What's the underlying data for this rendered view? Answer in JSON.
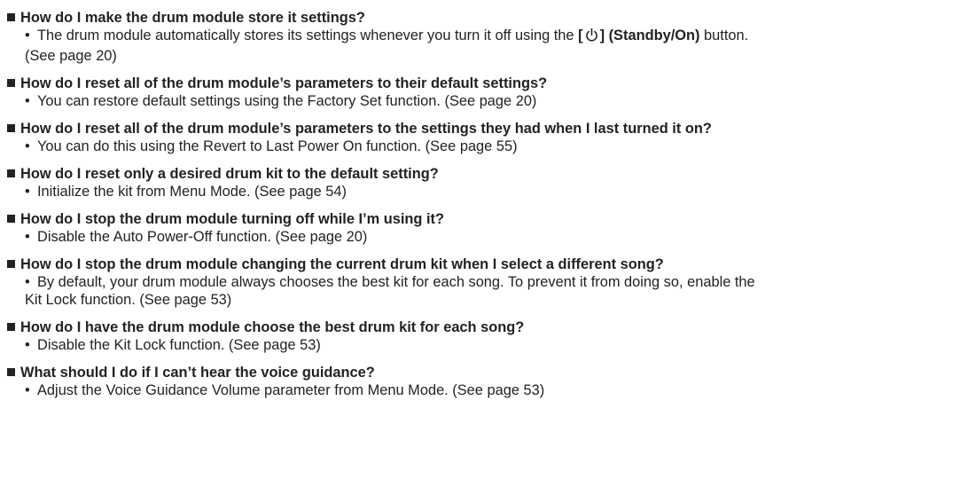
{
  "faq": [
    {
      "question": "How do I make the drum module store it settings?",
      "answer_pre": "The drum module automatically stores its settings whenever you turn it off using the ",
      "answer_bracket_open": "[",
      "answer_bracket_close": "]",
      "answer_bold": " (Standby/On)",
      "answer_post": " button.",
      "answer_line2": "(See page 20)",
      "icon": "power-icon"
    },
    {
      "question": "How do I reset all of the drum module’s parameters to their default settings?",
      "answer": "You can restore default settings using the Factory Set function. (See page 20)"
    },
    {
      "question": "How do I reset all of the drum module’s parameters to the settings they had when I last turned it on?",
      "answer": "You can do this using the Revert to Last Power On function. (See page 55)"
    },
    {
      "question": "How do I reset only a desired drum kit to the default setting?",
      "answer": "Initialize the kit from Menu Mode. (See page 54)"
    },
    {
      "question": "How do I stop the drum module turning off while I’m using it?",
      "answer": "Disable the Auto Power-Off function. (See page 20)"
    },
    {
      "question": "How do I stop the drum module changing the current drum kit when I select a different song?",
      "answer": "By default, your drum module always chooses the best kit for each song. To prevent it from doing so, enable the",
      "answer_line2": "Kit Lock function. (See page 53)"
    },
    {
      "question": "How do I have the drum module choose the best drum kit for each song?",
      "answer": "Disable the Kit Lock function. (See page 53)"
    },
    {
      "question": "What should I do if I can’t hear the voice guidance?",
      "answer": "Adjust the Voice Guidance Volume parameter from Menu Mode. (See page 53)"
    }
  ],
  "bullet_char": "•"
}
